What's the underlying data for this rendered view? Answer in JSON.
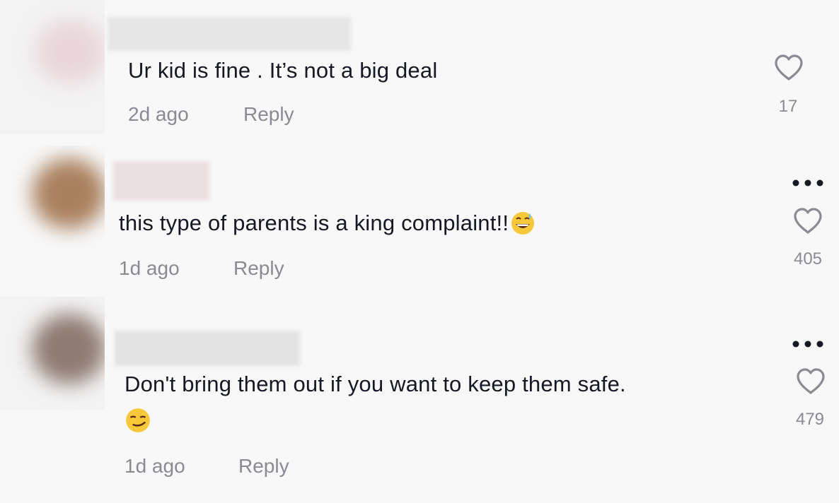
{
  "comments": [
    {
      "text": "Ur kid is fine . It’s not a big deal",
      "time": "2d ago",
      "reply_label": "Reply",
      "likes": "17",
      "avatar_color": "#e3c9cf",
      "emoji": ""
    },
    {
      "text": "this type of parents is a king complaint!!",
      "time": "1d ago",
      "reply_label": "Reply",
      "likes": "405",
      "avatar_color": "#a9805e",
      "emoji": "grinning-sweat-emoji"
    },
    {
      "text": "Don't bring them out if you want to keep them safe.",
      "time": "1d ago",
      "reply_label": "Reply",
      "likes": "479",
      "avatar_color": "#8e7b72",
      "emoji": "smirk-emoji"
    }
  ],
  "icons": {
    "like": "heart-outline-icon",
    "more": "more-dots-icon"
  },
  "colors": {
    "background": "#f8f8f8",
    "text": "#161823",
    "secondary": "#8a8b91"
  }
}
